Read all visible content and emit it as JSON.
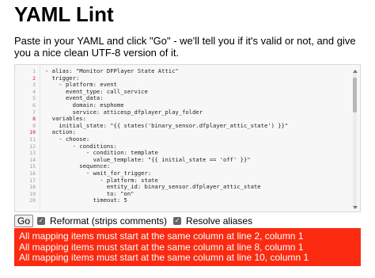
{
  "page": {
    "title": "YAML Lint",
    "intro": "Paste in your YAML and click \"Go\" - we'll tell you if it's valid or not, and give you a nice clean UTF-8 version of it."
  },
  "editor": {
    "line_numbers": [
      "1",
      "2",
      "3",
      "4",
      "5",
      "6",
      "7",
      "8",
      "9",
      "10",
      "11",
      "12",
      "13",
      "14",
      "15",
      "16",
      "17",
      "18",
      "19",
      "20"
    ],
    "error_lines": [
      "2",
      "8",
      "10"
    ],
    "lines": [
      "- alias: \"Monitor DFPlayer State Attic\"",
      "  trigger:",
      "    - platform: event",
      "      event_type: call_service",
      "      event_data:",
      "        domain: esphome",
      "        service: atticesp_dfplayer_play_folder",
      "  variables:",
      "    initial_state: \"{{ states('binary_sensor.dfplayer_attic_state') }}\"",
      "  action:",
      "    - choose:",
      "        - conditions:",
      "            - condition: template",
      "              value_template: \"{{ initial_state == 'off' }}\"",
      "          sequence:",
      "            - wait_for_trigger:",
      "                - platform: state",
      "                  entity_id: binary_sensor.dfplayer_attic_state",
      "                  to: \"on\"",
      "              timeout: 5"
    ]
  },
  "controls": {
    "go_label": "Go",
    "reformat_label": "Reformat (strips comments)",
    "reformat_checked": true,
    "resolve_label": "Resolve aliases",
    "resolve_checked": true,
    "checkmark": "✓"
  },
  "errors": [
    "All mapping items must start at the same column at line 2, column 1",
    "All mapping items must start at the same column at line 8, column 1",
    "All mapping items must start at the same column at line 10, column 1"
  ],
  "colors": {
    "error_background": "#fb2b11",
    "error_text": "#ffffff",
    "error_line_number": "#dd1111"
  }
}
